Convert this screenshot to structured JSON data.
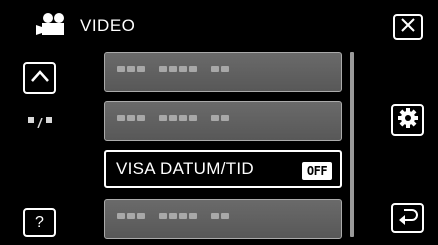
{
  "header": {
    "title": "VIDEO",
    "mode_icon": "video-camera-icon"
  },
  "buttons": {
    "close_icon": "close-icon",
    "up_icon": "chevron-up-icon",
    "settings_icon": "gear-icon",
    "help_label": "?",
    "back_icon": "return-icon"
  },
  "page_indicator": {
    "icon": "page-indicator-icon"
  },
  "menu": {
    "items": [
      {
        "label": "",
        "placeholder": true
      },
      {
        "label": "",
        "placeholder": true
      },
      {
        "label": "VISA DATUM/TID",
        "value": "OFF",
        "selected": true
      },
      {
        "label": "",
        "placeholder": true
      }
    ]
  },
  "colors": {
    "background": "#000000",
    "item_bg": "#606060",
    "text": "#ffffff"
  }
}
